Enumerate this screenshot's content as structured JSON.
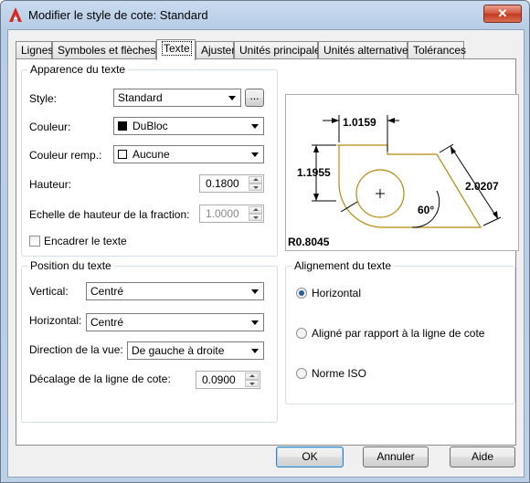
{
  "window": {
    "title": "Modifier le style de cote: Standard",
    "close_label": "✕"
  },
  "tabs": [
    {
      "label": "Lignes"
    },
    {
      "label": "Symboles et flèches"
    },
    {
      "label": "Texte"
    },
    {
      "label": "Ajuster"
    },
    {
      "label": "Unités principales"
    },
    {
      "label": "Unités alternatives"
    },
    {
      "label": "Tolérances"
    }
  ],
  "active_tab": "Texte",
  "appearance": {
    "title": "Apparence du texte",
    "style_label": "Style:",
    "style_value": "Standard",
    "browse_label": "...",
    "color_label": "Couleur:",
    "color_value": "DuBloc",
    "fill_label": "Couleur remp.:",
    "fill_value": "Aucune",
    "height_label": "Hauteur:",
    "height_value": "0.1800",
    "fraction_label": "Echelle de hauteur de la fraction:",
    "fraction_value": "1.0000",
    "frame_label": "Encadrer le texte",
    "frame_checked": false
  },
  "position": {
    "title": "Position du texte",
    "vertical_label": "Vertical:",
    "vertical_value": "Centré",
    "horizontal_label": "Horizontal:",
    "horizontal_value": "Centré",
    "direction_label": "Direction de la vue:",
    "direction_value": "De gauche à droite",
    "offset_label": "Décalage de la ligne de cote:",
    "offset_value": "0.0900"
  },
  "alignment": {
    "title": "Alignement du texte",
    "options": [
      {
        "label": "Horizontal",
        "checked": true
      },
      {
        "label": "Aligné par rapport à la ligne de cote",
        "checked": false
      },
      {
        "label": "Norme ISO",
        "checked": false
      }
    ]
  },
  "preview": {
    "dim_top": "1.0159",
    "dim_left": "1.1955",
    "dim_right": "2.0207",
    "dim_angle": "60°",
    "dim_radius": "R0.8045"
  },
  "buttons": {
    "ok": "OK",
    "cancel": "Annuler",
    "help": "Aide"
  },
  "colors": {
    "title_bar": "#bcd0e8",
    "accent": "#2a5b9a",
    "preview_geometry": "#b8860b"
  }
}
